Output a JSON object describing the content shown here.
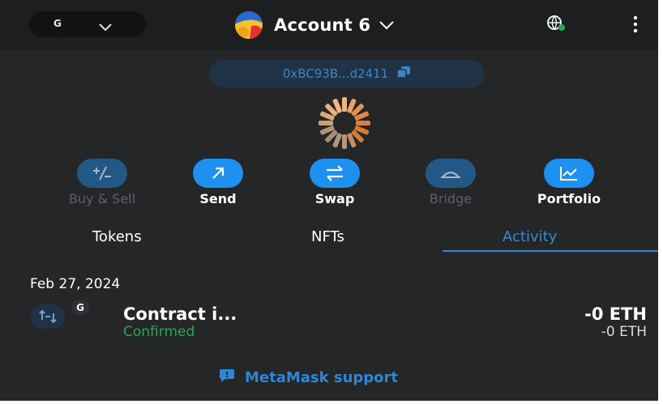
{
  "header": {
    "network_letter": "G",
    "account_name": "Account 6"
  },
  "address": {
    "short": "0xBC93B...d2411"
  },
  "actions": [
    {
      "label": "Buy & Sell",
      "icon": "buy-sell-icon",
      "enabled": false
    },
    {
      "label": "Send",
      "icon": "send-arrow-icon",
      "enabled": true
    },
    {
      "label": "Swap",
      "icon": "swap-icon",
      "enabled": true
    },
    {
      "label": "Bridge",
      "icon": "bridge-icon",
      "enabled": false
    },
    {
      "label": "Portfolio",
      "icon": "portfolio-chart-icon",
      "enabled": true
    }
  ],
  "tabs": [
    {
      "label": "Tokens",
      "active": false
    },
    {
      "label": "NFTs",
      "active": false
    },
    {
      "label": "Activity",
      "active": true
    }
  ],
  "activity": {
    "date": "Feb 27, 2024",
    "items": [
      {
        "badge": "G",
        "title": "Contract i...",
        "status": "Confirmed",
        "amount": "-0 ETH",
        "amount_secondary": "-0 ETH"
      }
    ]
  },
  "support": {
    "label": "MetaMask support"
  },
  "colors": {
    "background": "#242628",
    "header": "#1c1e20",
    "accent": "#1e90ef",
    "confirmed": "#2fa35a",
    "address_text": "#3d85c8"
  }
}
